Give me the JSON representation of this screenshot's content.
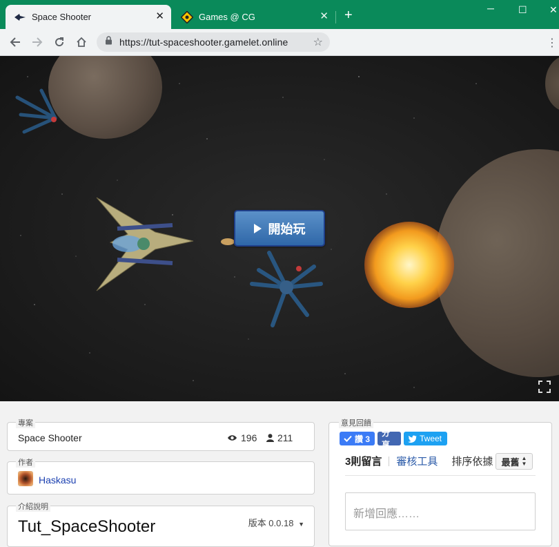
{
  "browser": {
    "tabs": [
      {
        "title": "Space Shooter",
        "icon": "spaceship-icon",
        "active": true
      },
      {
        "title": "Games @ CG",
        "icon": "gamelet-logo-icon",
        "active": false
      }
    ],
    "url": "https://tut-spaceshooter.gamelet.online"
  },
  "game": {
    "play_label": "開始玩"
  },
  "project": {
    "legend": "專案",
    "name": "Space Shooter",
    "views": "196",
    "players": "211"
  },
  "author": {
    "legend": "作者",
    "name": "Haskasu"
  },
  "description": {
    "legend": "介紹說明",
    "title": "Tut_SpaceShooter",
    "version": "版本 0.0.18"
  },
  "feedback": {
    "legend": "意見回饋",
    "like_count": "讚 3",
    "share_label": "分享",
    "tweet_label": "Tweet",
    "comments_tab": "3則留言",
    "moderation_tab": "審核工具",
    "sort_label": "排序依據",
    "sort_value": "最舊",
    "reply_placeholder": "新增回應……"
  },
  "colors": {
    "chrome_green": "#0a8a5a",
    "play_button": "#3f7bbb",
    "like_blue": "#3b7bf6",
    "share_blue": "#4267b2",
    "tweet_blue": "#1da1f2"
  }
}
